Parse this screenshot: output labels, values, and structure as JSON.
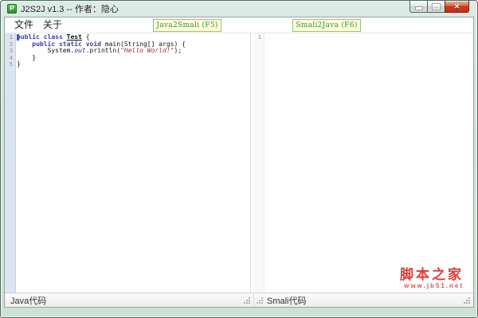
{
  "window": {
    "title": "J2S2J v1.3  --  作者：隐心",
    "icon_letter": "P",
    "controls": {
      "minimize": "minimize",
      "maximize": "maximize",
      "close_glyph": "✕"
    }
  },
  "menu": {
    "items": [
      {
        "label": "文件"
      },
      {
        "label": "关于"
      }
    ]
  },
  "toolbar": {
    "java2smali_label": "Java2Smali (F5)",
    "smali2java_label": "Smali2Java (F6)"
  },
  "left_editor": {
    "status_label": "Java代码",
    "line_numbers": [
      "1",
      "2",
      "3",
      "4",
      "5"
    ],
    "code": [
      {
        "tokens": [
          {
            "t": "public ",
            "s": "kw"
          },
          {
            "t": "class ",
            "s": "kw"
          },
          {
            "t": "Test",
            "s": "cls"
          },
          {
            "t": " {",
            "s": "plain"
          }
        ]
      },
      {
        "tokens": [
          {
            "t": "    ",
            "s": "plain"
          },
          {
            "t": "public static void",
            "s": "kw"
          },
          {
            "t": " main(String[] args) {",
            "s": "plain"
          }
        ]
      },
      {
        "tokens": [
          {
            "t": "        System.",
            "s": "plain"
          },
          {
            "t": "out",
            "s": "field"
          },
          {
            "t": ".println(",
            "s": "plain"
          },
          {
            "t": "\"Hello World!\"",
            "s": "str"
          },
          {
            "t": ");",
            "s": "plain"
          }
        ]
      },
      {
        "tokens": [
          {
            "t": "    }",
            "s": "plain"
          }
        ]
      },
      {
        "tokens": [
          {
            "t": "}",
            "s": "plain"
          }
        ]
      }
    ]
  },
  "right_editor": {
    "status_label": "Smali代码",
    "line_numbers": [
      "1"
    ]
  },
  "watermark": {
    "brand": "脚本之家",
    "url": "www.jb51.net"
  },
  "colors": {
    "button_bg": "#ffffd0",
    "button_border": "#8fc08f",
    "button_text": "#2e8b6e",
    "keyword": "#3b3bb8",
    "string": "#b03333",
    "static_field": "#2323c8",
    "gutter_bg": "#dbe6f2",
    "line_number": "#a5827c",
    "caret": "#3a57c4",
    "watermark_red": "#e03a3a",
    "close_button_red": "#cc3a1e",
    "app_icon_green": "#2f9230"
  }
}
